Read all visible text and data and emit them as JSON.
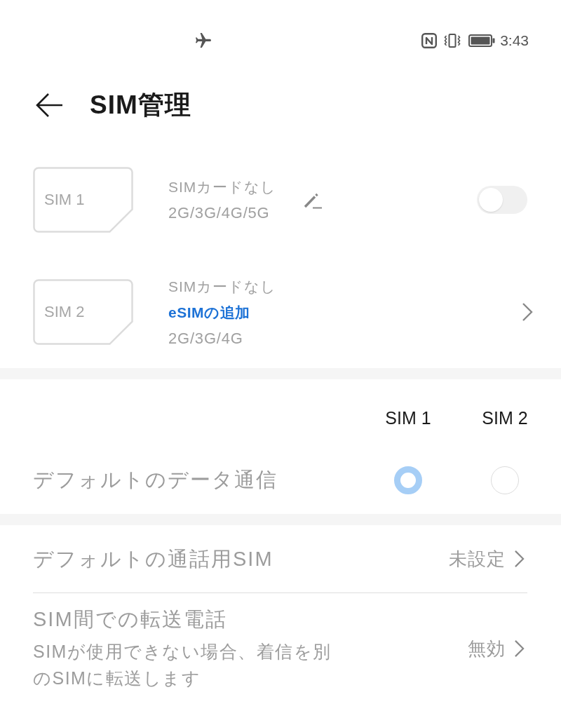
{
  "status_bar": {
    "time": "3:43"
  },
  "header": {
    "title": "SIM管理"
  },
  "sim_cards": [
    {
      "card_label": "SIM 1",
      "status": "SIMカードなし",
      "networks": "2G/3G/4G/5G",
      "kind": "toggle",
      "on": false
    },
    {
      "card_label": "SIM 2",
      "status": "SIMカードなし",
      "link": "eSIMの追加",
      "networks": "2G/3G/4G",
      "kind": "chevron"
    }
  ],
  "data_default": {
    "columns": [
      {
        "label": "SIM 1"
      },
      {
        "label": "SIM 2"
      }
    ],
    "label": "デフォルトのデータ通信",
    "disabled": true,
    "options": [
      {
        "selected": true
      },
      {
        "selected": false
      }
    ]
  },
  "settings": [
    {
      "title": "デフォルトの通話用SIM",
      "value": "未設定",
      "disabled": true
    },
    {
      "title": "SIM間での転送電話",
      "description": "SIMが使用できない場合、着信を別のSIMに転送します",
      "value": "無効",
      "disabled": true
    }
  ]
}
